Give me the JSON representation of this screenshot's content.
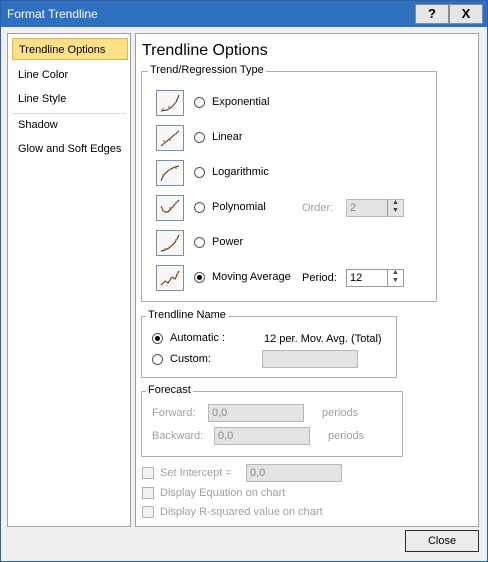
{
  "window": {
    "title": "Format Trendline",
    "help_label": "?",
    "close_label": "X"
  },
  "nav": {
    "items": [
      "Trendline Options",
      "Line Color",
      "Line Style",
      "Shadow",
      "Glow and Soft Edges"
    ]
  },
  "panel": {
    "heading": "Trendline Options",
    "type_group": "Trend/Regression Type",
    "types": [
      "Exponential",
      "Linear",
      "Logarithmic",
      "Polynomial",
      "Power",
      "Moving Average"
    ],
    "selected_type": "Moving Average",
    "order_label": "Order:",
    "order_value": "2",
    "period_label": "Period:",
    "period_value": "12",
    "name_group": "Trendline Name",
    "automatic_label": "Automatic :",
    "automatic_value": "12 per. Mov. Avg. (Total)",
    "custom_label": "Custom:",
    "custom_value": "",
    "forecast_group": "Forecast",
    "forward_label": "Forward:",
    "forward_value": "0,0",
    "backward_label": "Backward:",
    "backward_value": "0,0",
    "periods_label": "periods",
    "set_intercept_label": "Set Intercept =",
    "intercept_value": "0,0",
    "display_equation_label": "Display Equation on chart",
    "display_rsquared_label": "Display R-squared value on chart"
  },
  "footer": {
    "close_label": "Close"
  },
  "colors": {
    "titlebar": "#2e6fc0",
    "selected_nav": "#ffe08a"
  }
}
